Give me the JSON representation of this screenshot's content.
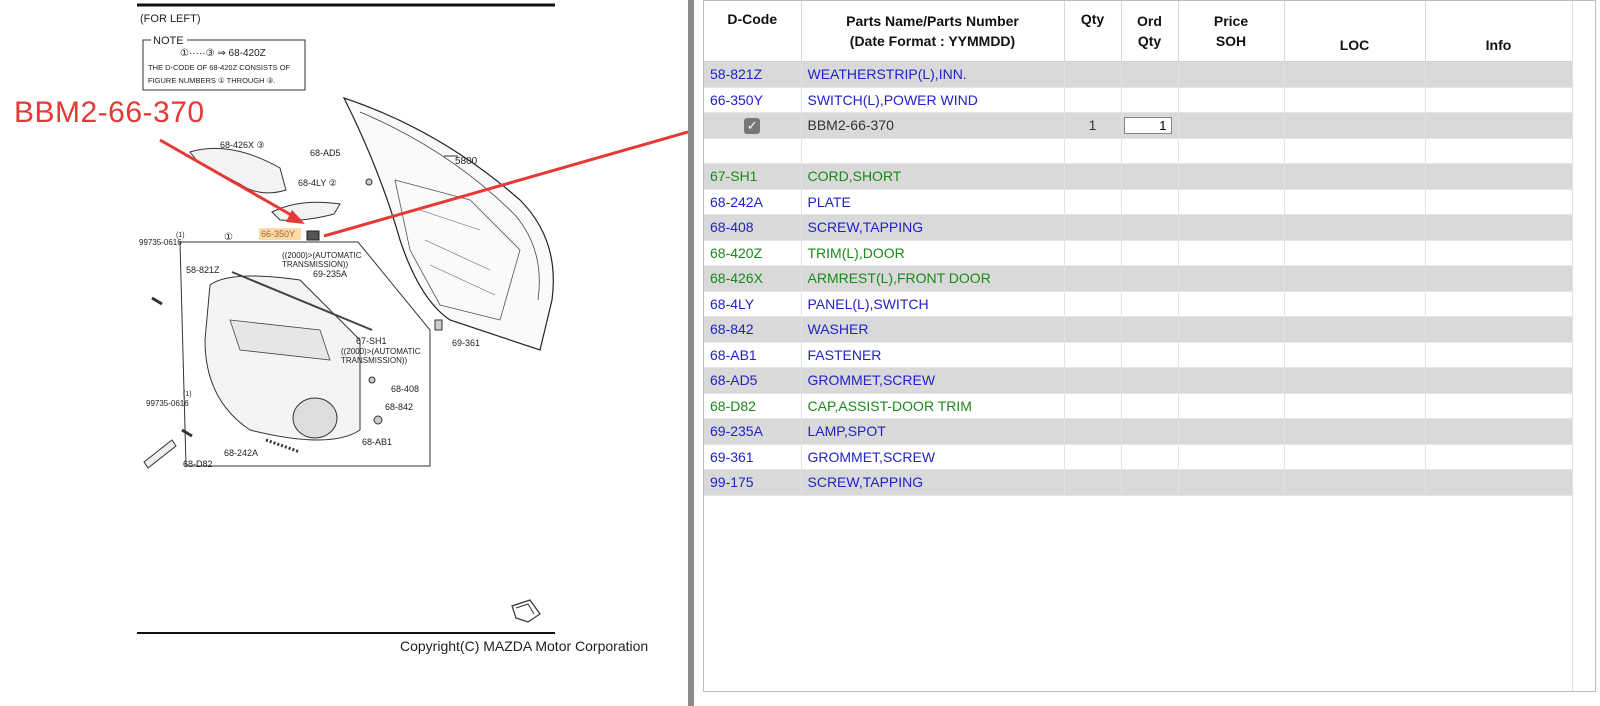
{
  "diagram": {
    "side_label": "(FOR LEFT)",
    "note_title": "NOTE",
    "note_line1": "①·····③ ⇒ 68-420Z",
    "note_line2": "THE D-CODE OF 68-420Z CONSISTS OF",
    "note_line3": "FIGURE NUMBERS ① THROUGH ③.",
    "callout": "BBM2-66-370",
    "labels": {
      "l_426x": "68-426X ③",
      "l_ad5": "68-AD5",
      "l_5800": "5800",
      "l_4ly": "68-4LY ②",
      "l_350y": "66-350Y",
      "l_99735a": "99735-0616",
      "l_99735a_cnt": "(1)",
      "l_fig1": "①",
      "l_auto1": "((2000)>(AUTOMATIC",
      "l_auto1b": "TRANSMISSION))",
      "l_235a": "69-235A",
      "l_821z": "58-821Z",
      "l_sh1": "67-SH1",
      "l_auto2": "((2000)>(AUTOMATIC",
      "l_auto2b": "TRANSMISSION))",
      "l_361": "69-361",
      "l_408": "68-408",
      "l_842": "68-842",
      "l_99735b_cnt": "(1)",
      "l_99735b": "99735-0616",
      "l_ab1": "68-AB1",
      "l_242a": "68-242A",
      "l_d82": "68-D82"
    },
    "copyright": "Copyright(C) MAZDA Motor Corporation"
  },
  "table": {
    "headers": {
      "dcode": "D-Code",
      "name1": "Parts Name/Parts Number",
      "name2": "(Date Format : YYMMDD)",
      "qty": "Qty",
      "ord1": "Ord",
      "ord2": "Qty",
      "price1": "Price",
      "price2": "SOH",
      "loc": "LOC",
      "info": "Info"
    },
    "rows": [
      {
        "dcode": "58-821Z",
        "name": "WEATHERSTRIP(L),INN.",
        "color": "blue"
      },
      {
        "dcode": "66-350Y",
        "name": "SWITCH(L),POWER WIND",
        "color": "blue"
      },
      {
        "dcode": "",
        "name": "BBM2-66-370",
        "color": "dark",
        "checked": true,
        "qty": "1",
        "ord_qty": "1"
      },
      {
        "dcode": "",
        "name": "",
        "color": "blue"
      },
      {
        "dcode": "67-SH1",
        "name": "CORD,SHORT",
        "color": "green"
      },
      {
        "dcode": "68-242A",
        "name": "PLATE",
        "color": "blue"
      },
      {
        "dcode": "68-408",
        "name": "SCREW,TAPPING",
        "color": "blue"
      },
      {
        "dcode": "68-420Z",
        "name": "TRIM(L),DOOR",
        "color": "green"
      },
      {
        "dcode": "68-426X",
        "name": "ARMREST(L),FRONT DOOR",
        "color": "green"
      },
      {
        "dcode": "68-4LY",
        "name": "PANEL(L),SWITCH",
        "color": "blue"
      },
      {
        "dcode": "68-842",
        "name": "WASHER",
        "color": "blue"
      },
      {
        "dcode": "68-AB1",
        "name": "FASTENER",
        "color": "blue"
      },
      {
        "dcode": "68-AD5",
        "name": "GROMMET,SCREW",
        "color": "blue"
      },
      {
        "dcode": "68-D82",
        "name": "CAP,ASSIST-DOOR TRIM",
        "color": "green"
      },
      {
        "dcode": "69-235A",
        "name": "LAMP,SPOT",
        "color": "blue"
      },
      {
        "dcode": "69-361",
        "name": "GROMMET,SCREW",
        "color": "blue"
      },
      {
        "dcode": "99-175",
        "name": "SCREW,TAPPING",
        "color": "blue"
      }
    ]
  },
  "colors": {
    "callout_red": "#e53935",
    "link_blue": "#2121c9",
    "link_green": "#188a18",
    "row_stripe": "#d9d9d9"
  }
}
